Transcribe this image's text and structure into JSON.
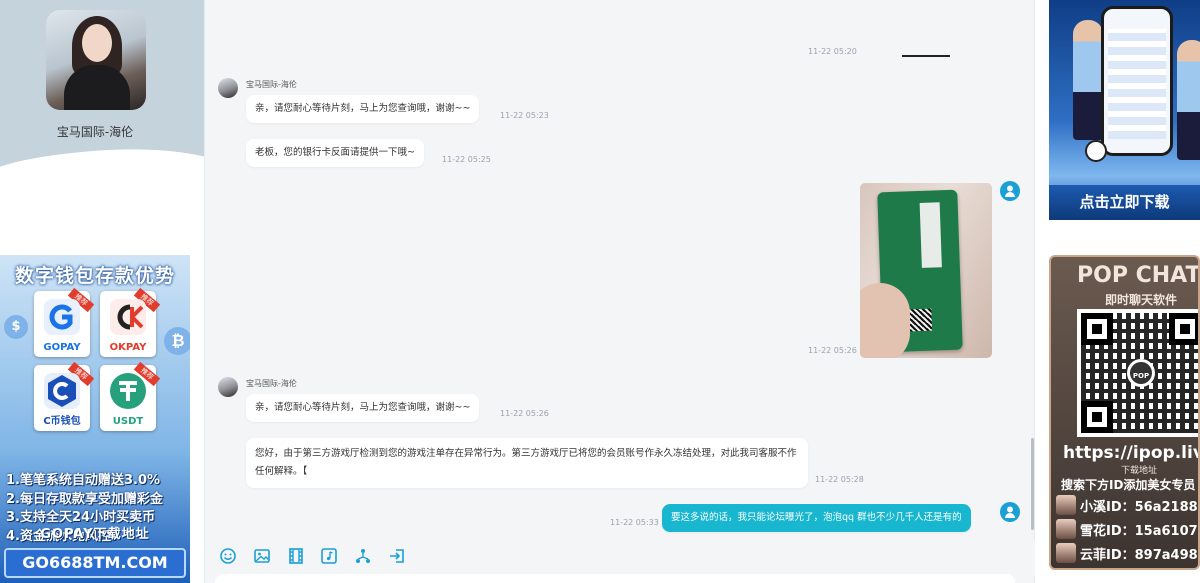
{
  "profile": {
    "name": "宝马国际-海伦"
  },
  "left_promo": {
    "title": "数字钱包存款优势",
    "tiles": [
      {
        "label": "GOPAY",
        "tag": "推荐",
        "color": "#1a73e8"
      },
      {
        "label": "OKPAY",
        "tag": "推荐",
        "color": "#e23c2d"
      },
      {
        "label": "C币钱包",
        "tag": "推荐",
        "color": "#1a4fb8"
      },
      {
        "label": "USDT",
        "tag": "推荐",
        "color": "#26a17b"
      }
    ],
    "lines": [
      "1.笔笔系统自动赠送3.0%",
      "2.每日存取款享受加赠彩金",
      "3.支持全天24小时买卖币",
      "4.资金流水免风控!"
    ],
    "cta": "GOPAY下载地址",
    "url": "GO6688TM.COM"
  },
  "messages": {
    "t0": "11-22 05:20",
    "group1": {
      "sender": "宝马国际-海伦",
      "m1": {
        "text": "亲，请您耐心等待片刻，马上为您查询哦，谢谢~~",
        "time": "11-22 05:23"
      },
      "m2": {
        "text": "老板，您的银行卡反面请提供一下哦~",
        "time": "11-22 05:25"
      }
    },
    "image_msg": {
      "time": "11-22 05:26"
    },
    "group2": {
      "sender": "宝马国际-海伦",
      "m1": {
        "text": "亲，请您耐心等待片刻，马上为您查询哦，谢谢~~",
        "time": "11-22 05:26"
      },
      "m2": {
        "text": "您好，由于第三方游戏厅检测到您的游戏注单存在异常行为。第三方游戏厅已将您的会员账号作永久冻结处理，对此我司客服不作任何解释。【",
        "time": "11-22 05:28"
      }
    },
    "user_msg": {
      "text": "要这多说的话，我只能论坛曝光了，泡泡qq 群也不少几千人还是有的",
      "time": "11-22 05:33"
    }
  },
  "toolbar": {
    "icons": [
      "emoji-icon",
      "image-icon",
      "video-icon",
      "audio-icon",
      "share-icon",
      "transfer-icon"
    ]
  },
  "right_ads": {
    "phone_ad": {
      "cta": "点击立即下载"
    },
    "pop_ad": {
      "title": "POP CHAT",
      "subtitle": "即时聊天软件",
      "qr_center": "POP",
      "url": "https://ipop.liv",
      "dl_label": "下载地址",
      "search_text": "搜索下方ID添加美女专员",
      "ids": [
        "小溪ID：56a2188",
        "雪花ID：15a6107",
        "云菲ID：897a498"
      ]
    }
  },
  "colors": {
    "accent": "#19b7cf",
    "user_avatar": "#1a9fd6"
  }
}
